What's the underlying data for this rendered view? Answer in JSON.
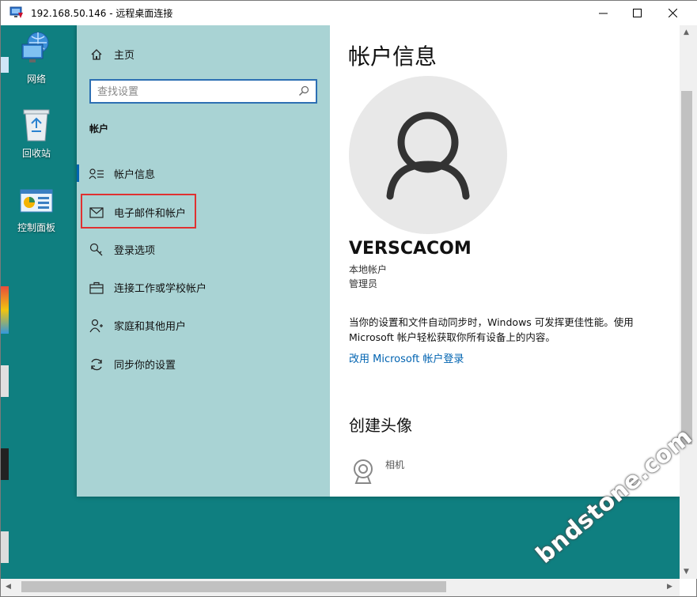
{
  "window": {
    "title": "192.168.50.146 - 远程桌面连接"
  },
  "desktop": {
    "icons": [
      {
        "label": "网络",
        "icon": "network-icon"
      },
      {
        "label": "回收站",
        "icon": "recycle-bin-icon"
      },
      {
        "label": "控制面板",
        "icon": "control-panel-icon"
      }
    ],
    "background_color": "#0f7f80"
  },
  "settings": {
    "sidebar": {
      "home_label": "主页",
      "search_placeholder": "查找设置",
      "section_label": "帐户",
      "items": [
        {
          "label": "帐户信息",
          "icon": "account-info-icon",
          "active": true
        },
        {
          "label": "电子邮件和帐户",
          "icon": "mail-icon",
          "highlighted": true
        },
        {
          "label": "登录选项",
          "icon": "key-icon"
        },
        {
          "label": "连接工作或学校帐户",
          "icon": "briefcase-icon"
        },
        {
          "label": "家庭和其他用户",
          "icon": "add-person-icon"
        },
        {
          "label": "同步你的设置",
          "icon": "sync-icon"
        }
      ]
    },
    "main": {
      "title": "帐户信息",
      "username": "VERSCACOM",
      "account_type": "本地帐户",
      "account_role": "管理员",
      "sync_text": "当你的设置和文件自动同步时，Windows 可发挥更佳性能。使用 Microsoft 帐户轻松获取你所有设备上的内容。",
      "ms_link": "改用 Microsoft 帐户登录",
      "create_avatar_title": "创建头像",
      "camera_label": "相机"
    }
  },
  "watermark": "bndstone.com",
  "colors": {
    "accent": "#0063b1",
    "sidebar_bg": "#a9d3d4",
    "highlight_border": "#e03131"
  }
}
